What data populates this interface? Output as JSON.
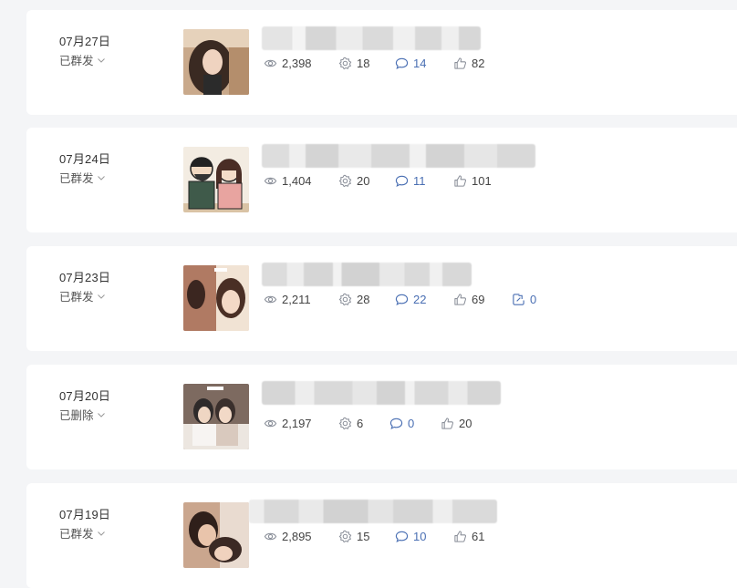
{
  "colors": {
    "page_bg": "#f4f5f7",
    "card_bg": "#ffffff",
    "accent_blue": "#4a6fb3",
    "icon_gray": "#8a8f99"
  },
  "posts": [
    {
      "date": "07月27日",
      "status": "已群发",
      "views": "2,398",
      "shares": "18",
      "comments": "14",
      "likes": "82"
    },
    {
      "date": "07月24日",
      "status": "已群发",
      "views": "1,404",
      "shares": "20",
      "comments": "11",
      "likes": "101"
    },
    {
      "date": "07月23日",
      "status": "已群发",
      "views": "2,211",
      "shares": "28",
      "comments": "22",
      "likes": "69",
      "forwards": "0"
    },
    {
      "date": "07月20日",
      "status": "已删除",
      "views": "2,197",
      "shares": "6",
      "comments": "0",
      "likes": "20"
    },
    {
      "date": "07月19日",
      "status": "已群发",
      "views": "2,895",
      "shares": "15",
      "comments": "10",
      "likes": "61"
    }
  ],
  "icons": {
    "views": "eye-icon",
    "shares": "gear-share-icon",
    "comments": "comment-bubble-icon",
    "likes": "thumbs-up-icon",
    "forwards": "forward-icon",
    "status_toggle": "chevron-down-icon"
  }
}
